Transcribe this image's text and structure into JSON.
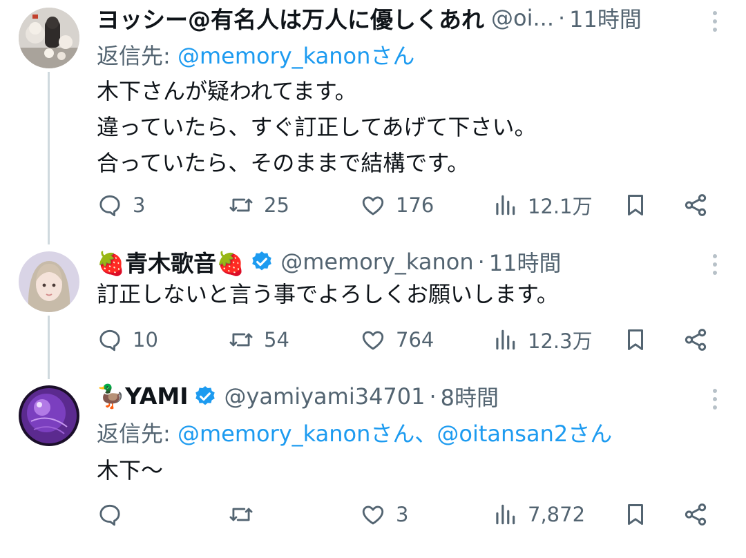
{
  "tweets": [
    {
      "name": "ヨッシー@有名人は万人に優しくあれ",
      "handle": "@oi...",
      "time": "11時間",
      "reply_prefix": "返信先:",
      "reply_links": "@memory_kanonさん",
      "lines": [
        "木下さんが疑われてます。",
        "違っていたら、すぐ訂正してあげて下さい。",
        "合っていたら、そのままで結構です。"
      ],
      "replies": "3",
      "retweets": "25",
      "likes": "176",
      "views": "12.1万"
    },
    {
      "name": "🍓青木歌音🍓",
      "handle": "@memory_kanon",
      "time": "11時間",
      "lines": [
        "訂正しないと言う事でよろしくお願いします。"
      ],
      "replies": "10",
      "retweets": "54",
      "likes": "764",
      "views": "12.3万"
    },
    {
      "name": "🦆YAMI",
      "handle": "@yamiyami34701",
      "time": "8時間",
      "reply_prefix": "返信先:",
      "reply_links": "@memory_kanonさん、@oitansan2さん",
      "lines": [
        "木下〜"
      ],
      "replies": "",
      "retweets": "",
      "likes": "3",
      "views": "7,872"
    }
  ],
  "colors": {
    "link": "#1d9bf0",
    "muted": "#536471",
    "verified": "#1d9bf0",
    "thread_line": "#cfd9de"
  },
  "icons": [
    "reply-icon",
    "retweet-icon",
    "like-icon",
    "views-icon",
    "bookmark-icon",
    "share-icon",
    "more-icon",
    "verified-badge-icon"
  ]
}
